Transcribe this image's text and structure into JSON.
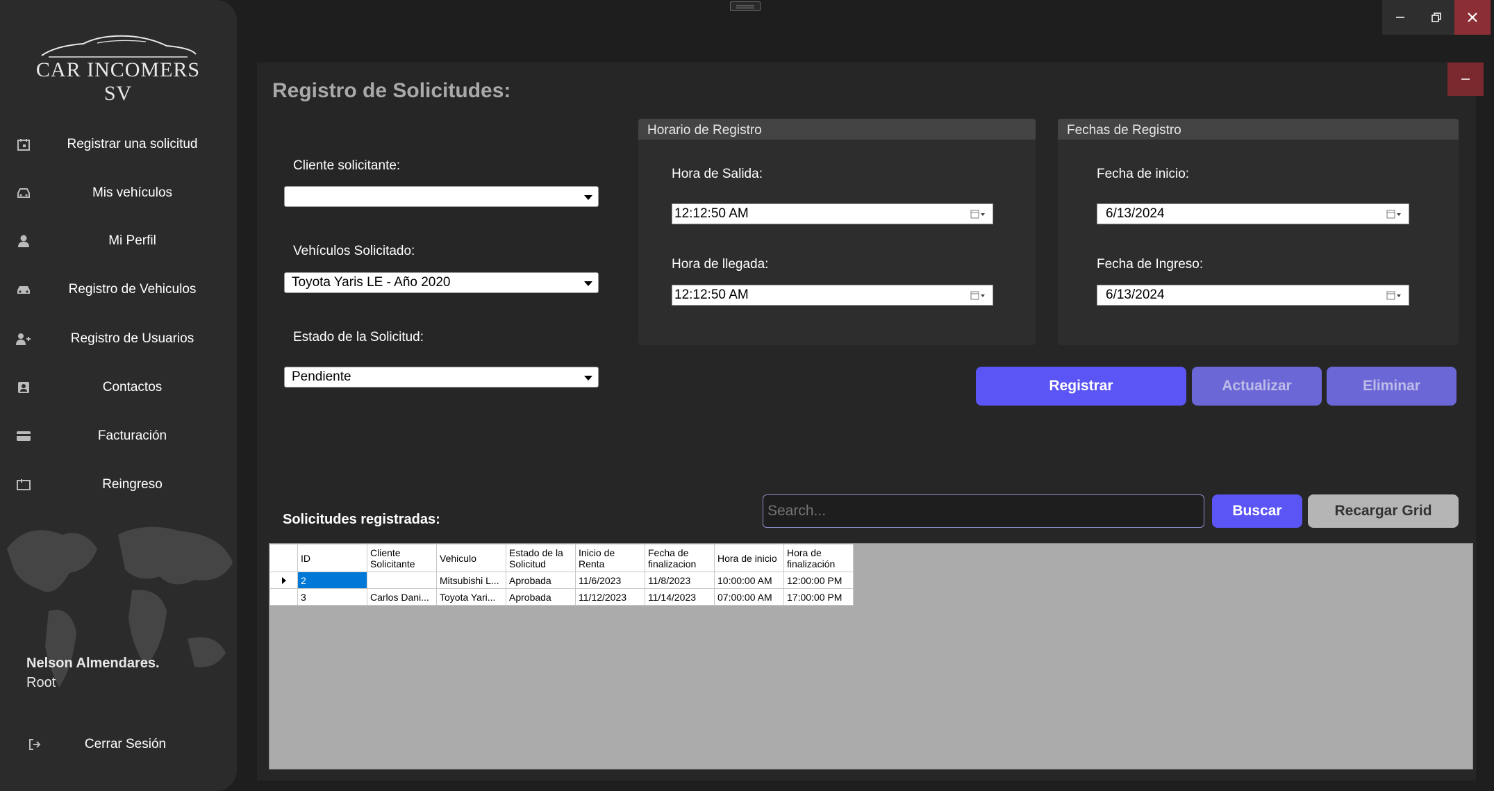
{
  "app": {
    "brand": "CAR INCOMERS SV"
  },
  "window": {
    "minimize": "minimize",
    "restore": "restore",
    "close": "close"
  },
  "sidebar": {
    "items": [
      {
        "label": "Registrar una solicitud",
        "icon": "calendar-icon"
      },
      {
        "label": "Mis vehículos",
        "icon": "car-front-icon"
      },
      {
        "label": "Mi Perfil",
        "icon": "user-icon"
      },
      {
        "label": "Registro de Vehiculos",
        "icon": "car-icon"
      },
      {
        "label": "Registro de Usuarios",
        "icon": "add-user-icon"
      },
      {
        "label": "Contactos",
        "icon": "contacts-icon"
      },
      {
        "label": "Facturación",
        "icon": "card-icon"
      },
      {
        "label": "Reingreso",
        "icon": "reentry-icon"
      }
    ],
    "user": {
      "name": "Nelson Almendares.",
      "role": "Root"
    },
    "logout": "Cerrar Sesión"
  },
  "page": {
    "title": "Registro de Solicitudes:"
  },
  "form": {
    "cliente_label": "Cliente solicitante:",
    "cliente_value": "",
    "vehiculo_label": "Vehículos Solicitado:",
    "vehiculo_value": "Toyota Yaris LE - Año  2020",
    "estado_label": "Estado de la Solicitud:",
    "estado_value": "Pendiente"
  },
  "horario": {
    "title": "Horario de Registro",
    "salida_label": "Hora de Salida:",
    "salida_value": "12:12:50 AM",
    "llegada_label": "Hora de llegada:",
    "llegada_value": "12:12:50 AM"
  },
  "fechas": {
    "title": "Fechas de Registro",
    "inicio_label": "Fecha de inicio:",
    "inicio_value": "6/13/2024",
    "ingreso_label": "Fecha de Ingreso:",
    "ingreso_value": "6/13/2024"
  },
  "actions": {
    "registrar": "Registrar",
    "actualizar": "Actualizar",
    "eliminar": "Eliminar"
  },
  "list": {
    "title": "Solicitudes registradas:",
    "search_placeholder": "Search...",
    "buscar": "Buscar",
    "recargar": "Recargar Grid"
  },
  "grid": {
    "columns": [
      "ID",
      "Cliente Solicitante",
      "Vehiculo",
      "Estado de la Solicitud",
      "Inicio de Renta",
      "Fecha de finalizacion",
      "Hora de inicio",
      "Hora de finalización"
    ],
    "rows": [
      [
        "2",
        "",
        "Mitsubishi L...",
        "Aprobada",
        "11/6/2023",
        "11/8/2023",
        "10:00:00  AM",
        "12:00:00  PM"
      ],
      [
        "3",
        "Carlos Dani...",
        "Toyota Yari...",
        "Aprobada",
        "11/12/2023",
        "11/14/2023",
        "07:00:00  AM",
        "17:00:00  PM"
      ]
    ]
  },
  "colors": {
    "primary": "#5b55f5",
    "primary_muted": "#6c67d6",
    "sidebar": "#2b2b2b",
    "background": "#1e1e1e",
    "panel": "#262626",
    "close": "#8b2e35"
  }
}
